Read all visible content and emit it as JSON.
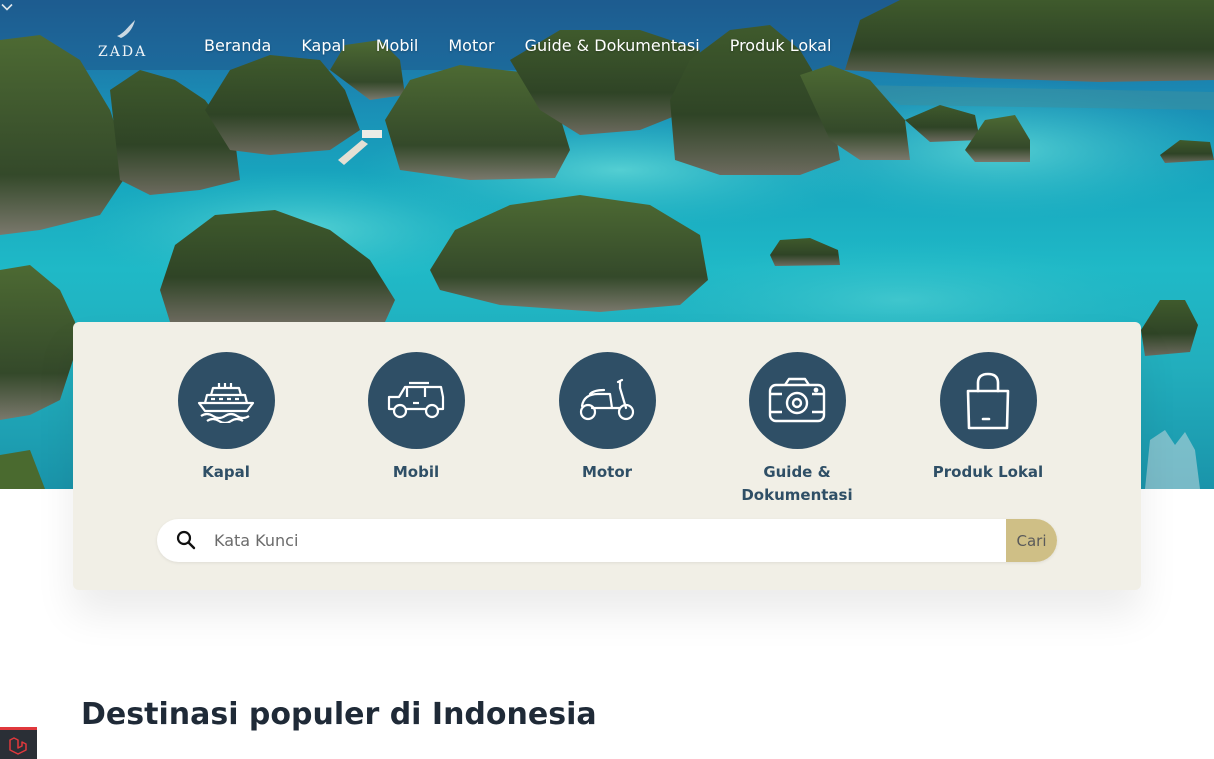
{
  "brand": {
    "name": "ZADA"
  },
  "nav": {
    "items": [
      "Beranda",
      "Kapal",
      "Mobil",
      "Motor",
      "Guide & Dokumentasi",
      "Produk Lokal"
    ]
  },
  "categories": [
    {
      "label": "Kapal",
      "icon": "ship-icon"
    },
    {
      "label": "Mobil",
      "icon": "car-icon"
    },
    {
      "label": "Motor",
      "icon": "scooter-icon"
    },
    {
      "label": "Guide & Dokumentasi",
      "icon": "camera-icon"
    },
    {
      "label": "Produk Lokal",
      "icon": "shopping-bag-icon"
    }
  ],
  "search": {
    "placeholder": "Kata Kunci",
    "button_label": "Cari"
  },
  "section": {
    "title": "Destinasi populer di Indonesia"
  },
  "colors": {
    "accent": "#2f4f66",
    "button": "#cfbf86",
    "panel": "#f1efe6",
    "heading": "#1f2a37"
  }
}
